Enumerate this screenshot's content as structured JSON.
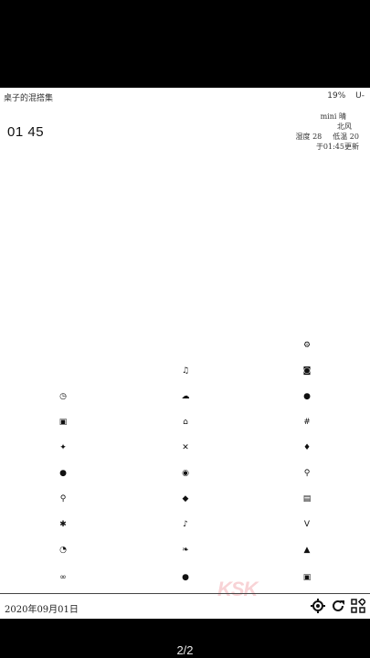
{
  "status": {
    "app_title": "桌子的混搭集",
    "battery": "19%",
    "signal": "U-"
  },
  "clock": {
    "time": "01 45"
  },
  "weather": {
    "location": "mini 晴",
    "location2": "北风",
    "humidity": "湿度 28",
    "low_temp": "低温 20",
    "updated": "于01:45更新"
  },
  "apps": [
    {
      "name": "settings-gear-icon",
      "glyph": "⚙"
    },
    {
      "name": "music-icon",
      "glyph": "♫"
    },
    {
      "name": "camera-icon",
      "glyph": "◙"
    },
    {
      "name": "clock-icon",
      "glyph": "◷"
    },
    {
      "name": "chat-icon",
      "glyph": "☁"
    },
    {
      "name": "browser-icon",
      "glyph": "●"
    },
    {
      "name": "gallery-icon",
      "glyph": "▣"
    },
    {
      "name": "store-icon",
      "glyph": "⌂"
    },
    {
      "name": "hashtag-icon",
      "glyph": "#"
    },
    {
      "name": "bird-icon",
      "glyph": "✦"
    },
    {
      "name": "close-x-icon",
      "glyph": "✕"
    },
    {
      "name": "flame-icon",
      "glyph": "♦"
    },
    {
      "name": "record-icon",
      "glyph": "●"
    },
    {
      "name": "qq-icon",
      "glyph": "◉"
    },
    {
      "name": "search-small-icon",
      "glyph": "⚲"
    },
    {
      "name": "search-icon",
      "glyph": "⚲"
    },
    {
      "name": "gamepad-icon",
      "glyph": "◆"
    },
    {
      "name": "notes-icon",
      "glyph": "▤"
    },
    {
      "name": "satellite-icon",
      "glyph": "✱"
    },
    {
      "name": "tiktok-icon",
      "glyph": "♪"
    },
    {
      "name": "v-icon",
      "glyph": "V"
    },
    {
      "name": "timer-icon",
      "glyph": "◔"
    },
    {
      "name": "leaf-icon",
      "glyph": "❧"
    },
    {
      "name": "mountain-icon",
      "glyph": "▲"
    },
    {
      "name": "vr-icon",
      "glyph": "∞"
    },
    {
      "name": "apple-icon",
      "glyph": "●"
    },
    {
      "name": "media-icon",
      "glyph": "▣"
    }
  ],
  "footer": {
    "date": "2020年09月01日",
    "watermark": "KSK"
  },
  "page_indicator": "2/2"
}
